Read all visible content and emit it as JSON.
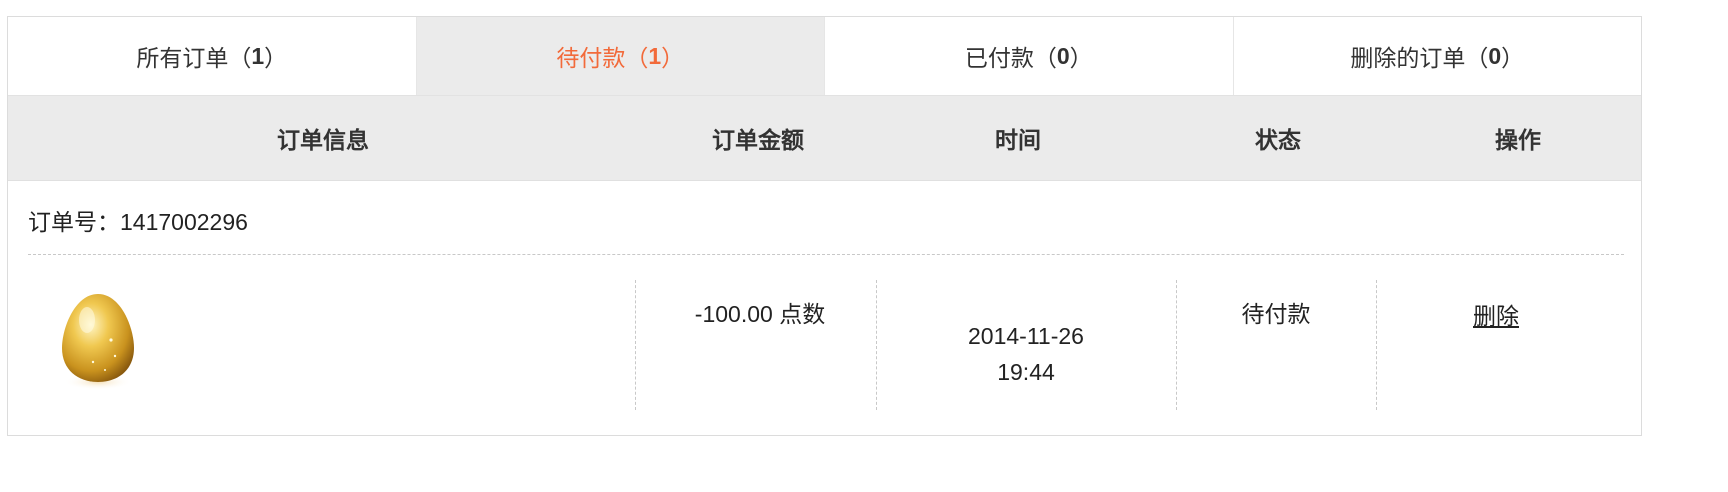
{
  "tabs": [
    {
      "label": "所有订单（",
      "count": "1",
      "suffix": "）"
    },
    {
      "label": "待付款（",
      "count": "1",
      "suffix": "）",
      "active": true
    },
    {
      "label": "已付款（",
      "count": "0",
      "suffix": "）"
    },
    {
      "label": "删除的订单（",
      "count": "0",
      "suffix": "）"
    }
  ],
  "headers": {
    "info": "订单信息",
    "amount": "订单金额",
    "time": "时间",
    "status": "状态",
    "action": "操作"
  },
  "order": {
    "number_label": "订单号：1417002296",
    "amount": "-100.00 点数",
    "date": "2014-11-26",
    "time": "19:44",
    "status": "待付款",
    "delete_label": "删除",
    "product_icon": "golden-egg-icon"
  },
  "colors": {
    "accent": "#f26a3a",
    "header_bg": "#ebebeb",
    "border": "#dcdcdc"
  }
}
